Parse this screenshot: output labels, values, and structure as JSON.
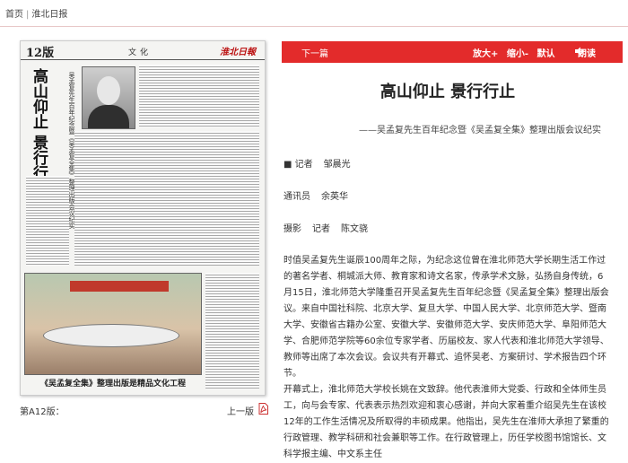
{
  "breadcrumb": {
    "home": "首页",
    "separator": "|",
    "current": "淮北日报"
  },
  "paper_page": {
    "page_no": "12版",
    "section": "文化",
    "masthead": "淮北日報",
    "vertical_title": "高山仰止 景行行止",
    "vertical_subtitle": "吴孟复先生百年纪念暨《吴孟复全集》整理出版会议纪实",
    "photo_caption": "《吴孟复全集》整理出版是精品文化工程"
  },
  "bottom": {
    "edition_label": "第A12版：",
    "prev_label": "上一版"
  },
  "toolbar": {
    "next_label": "下一篇",
    "zoom_in": "放大+",
    "zoom_out": "缩小-",
    "default": "默认",
    "read": "朗读"
  },
  "article": {
    "title": "高山仰止 景行行止",
    "subtitle": "——吴孟复先生百年纪念暨《吴孟复全集》整理出版会议纪实",
    "reporter_label": "■ 记者",
    "reporter_name": "邹晨光",
    "correspondent_label": "通讯员",
    "correspondent_name": "余英华",
    "photo_label": "摄影",
    "photo_reporter_label": "记者",
    "photographer_name": "陈文骁",
    "para1": "时值吴孟复先生诞辰100周年之际，为纪念这位曾在淮北师范大学长期生活工作过的著名学者、桐城派大师、教育家和诗文名家，传承学术文脉，弘扬自身传统，6月15日，淮北师范大学隆重召开吴孟复先生百年纪念暨《吴孟复全集》整理出版会议。来自中国社科院、北京大学、复旦大学、中国人民大学、北京师范大学、暨南大学、安徽省古籍办公室、安徽大学、安徽师范大学、安庆师范大学、阜阳师范大学、合肥师范学院等60余位专家学者、历届校友、家人代表和淮北师范大学领导、教师等出席了本次会议。会议共有开幕式、追怀吴老、方案研讨、学术报告四个环节。",
    "para2": "开幕式上，淮北师范大学校长姚在文致辞。他代表淮师大党委、行政和全体师生员工，向与会专家、代表表示热烈欢迎和衷心感谢，并向大家着重介绍吴先生在该校12年的工作生活情况及所取得的丰硕成果。他指出，吴先生在淮师大承担了繁重的行政管理、教学科研和社会兼职等工作。在行政管理上，历任学校图书馆馆长、文科学报主编、中文系主任"
  },
  "colors": {
    "accent": "#e32b2b",
    "text": "#333333"
  },
  "icons": {
    "pdf": "pdf-icon",
    "speaker": "speaker-icon"
  }
}
